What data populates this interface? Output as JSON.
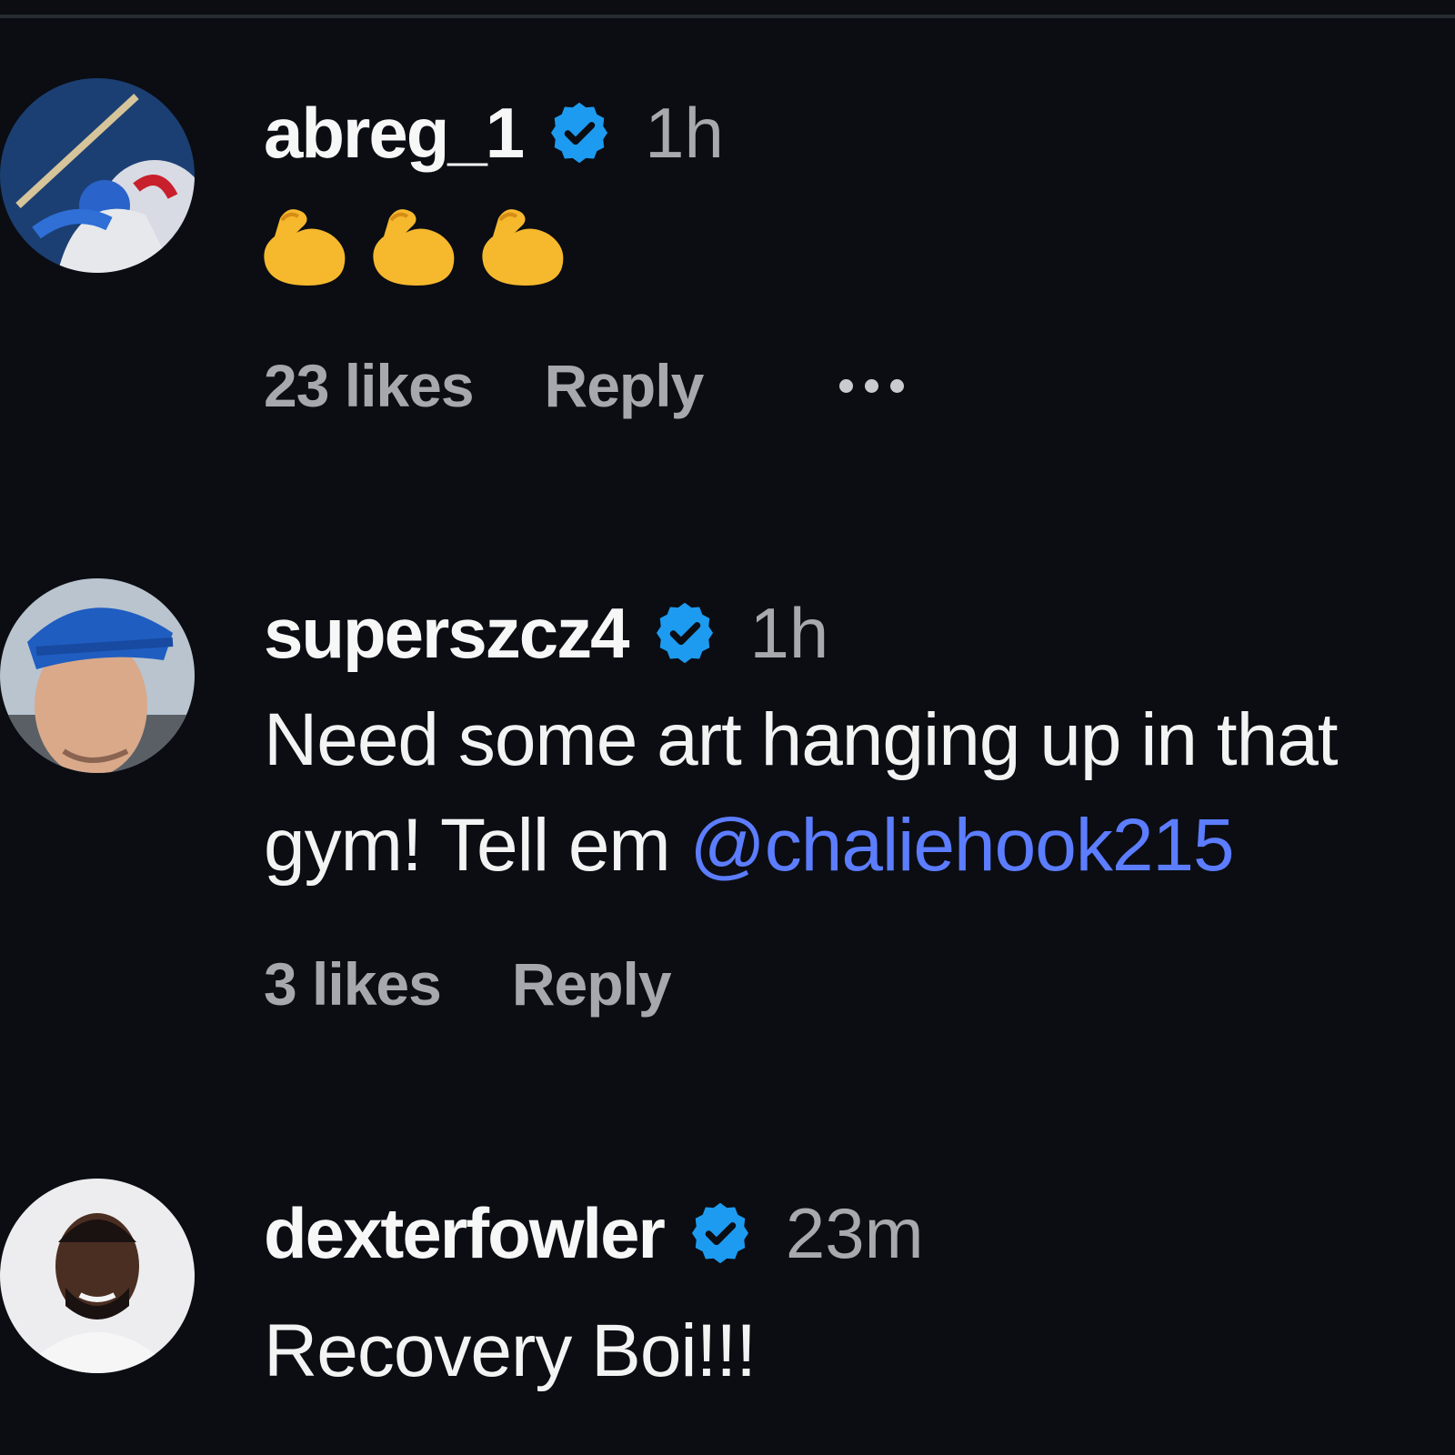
{
  "comments": [
    {
      "username": "abreg_1",
      "time": "1h",
      "text": "💪💪💪",
      "likes": "23 likes",
      "reply": "Reply"
    },
    {
      "username": "superszcz4",
      "time": "1h",
      "text_line1": "Need some art hanging up in that",
      "text_line2": "gym! Tell em ",
      "mention": "@chaliehook215",
      "likes": "3 likes",
      "reply": "Reply"
    },
    {
      "username": "dexterfowler",
      "time": "23m",
      "text": "Recovery Boi!!!"
    }
  ],
  "colors": {
    "background": "#0b0d13",
    "verified_badge": "#1d9bf0",
    "mention": "#5c7dff",
    "muted_text": "#a6a8ad"
  },
  "icons": {
    "verified": "verified-badge-icon",
    "more": "more-options-icon",
    "flexed_biceps": "flexed-biceps-icon"
  }
}
